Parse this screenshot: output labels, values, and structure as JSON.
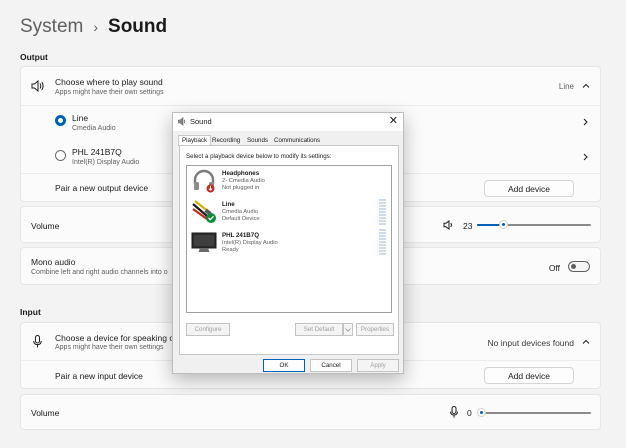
{
  "breadcrumb": {
    "parent": "System",
    "separator": "›",
    "current": "Sound"
  },
  "output": {
    "section_label": "Output",
    "choose": {
      "title": "Choose where to play sound",
      "subtitle": "Apps might have their own settings",
      "selected_value": "Line"
    },
    "devices": [
      {
        "name": "Line",
        "detail": "Cmedia Audio",
        "selected": true
      },
      {
        "name": "PHL 241B7Q",
        "detail": "Intel(R) Display Audio",
        "selected": false
      }
    ],
    "pair_label": "Pair a new output device",
    "add_device_label": "Add device",
    "volume_label": "Volume",
    "volume_value": "23",
    "volume_fraction": 0.23,
    "mono": {
      "title": "Mono audio",
      "subtitle": "Combine left and right audio channels into o",
      "state_label": "Off"
    }
  },
  "input": {
    "section_label": "Input",
    "choose": {
      "title": "Choose a device for speaking or",
      "subtitle": "Apps might have their own settings",
      "status": "No input devices found"
    },
    "pair_label": "Pair a new input device",
    "add_device_label": "Add device",
    "volume_label": "Volume",
    "volume_value": "0",
    "volume_fraction": 0
  },
  "dialog": {
    "title": "Sound",
    "close_glyph": "✕",
    "tabs": [
      "Playback",
      "Recording",
      "Sounds",
      "Communications"
    ],
    "instruction": "Select a playback device below to modify its settings:",
    "devices": [
      {
        "name": "Headphones",
        "line2": "2- Cmedia Audio",
        "line3": "Not plugged in"
      },
      {
        "name": "Line",
        "line2": "Cmedia Audio",
        "line3": "Default Device"
      },
      {
        "name": "PHL 241B7Q",
        "line2": "Intel(R) Display Audio",
        "line3": "Ready"
      }
    ],
    "configure_label": "Configure",
    "set_default_label": "Set Default",
    "properties_label": "Properties",
    "ok_label": "OK",
    "cancel_label": "Cancel",
    "apply_label": "Apply"
  },
  "colors": {
    "accent": "#005fb8",
    "background": "#f3f3f3",
    "card": "#fbfbfb"
  }
}
